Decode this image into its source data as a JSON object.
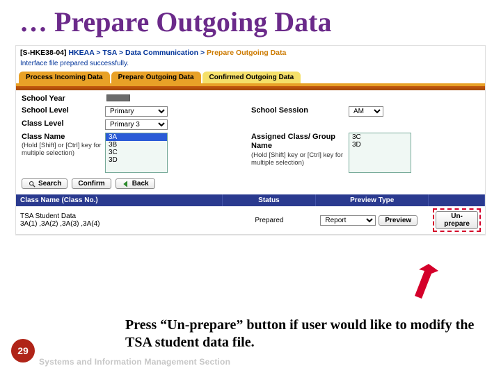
{
  "title": "… Prepare Outgoing Data",
  "breadcrumb": {
    "code": "[S-HKE38-04]",
    "path1": "HKEAA",
    "path2": "TSA",
    "path3": "Data Communication",
    "current": "Prepare Outgoing Data"
  },
  "status_message": "Interface file prepared successfully.",
  "tabs": {
    "t1": "Process Incoming Data",
    "t2": "Prepare Outgoing Data",
    "t3": "Confirmed Outgoing Data"
  },
  "form": {
    "school_year_label": "School Year",
    "school_level_label": "School Level",
    "school_level_value": "Primary",
    "school_session_label": "School Session",
    "school_session_value": "AM",
    "class_level_label": "Class Level",
    "class_level_value": "Primary 3",
    "class_name_label": "Class Name",
    "class_name_hint": "(Hold [Shift] or [Ctrl] key for multiple selection)",
    "class_list": [
      "3A",
      "3B",
      "3C",
      "3D"
    ],
    "class_selected_index": 0,
    "assigned_label": "Assigned Class/ Group Name",
    "assigned_hint": "(Hold [Shift] key or [Ctrl] key for multiple selection)",
    "assigned_list": [
      "3C",
      "3D"
    ]
  },
  "actions": {
    "search": "Search",
    "confirm": "Confirm",
    "back": "Back"
  },
  "grid": {
    "h1": "Class Name (Class No.)",
    "h2": "Status",
    "h3": "Preview Type",
    "h4": "",
    "row1_name": "TSA Student Data",
    "row1_detail": "3A(1) ,3A(2) ,3A(3) ,3A(4)",
    "row1_status": "Prepared",
    "row1_preview_type": "Report",
    "preview_btn": "Preview",
    "unprepare_btn": "Un-prepare"
  },
  "caption": "Press “Un-prepare” button if user would like to modify the TSA student data file.",
  "page_number": "29",
  "footer": "Systems and Information Management Section"
}
